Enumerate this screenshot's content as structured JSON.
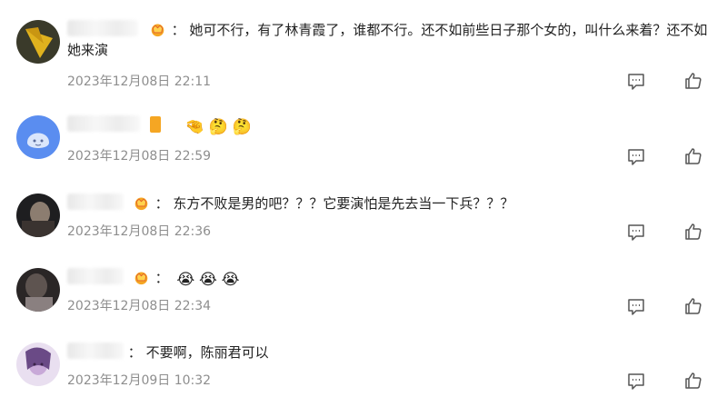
{
  "comments": [
    {
      "username": "",
      "separator": "：",
      "text": "她可不行，有了林青霞了，谁都不行。还不如前些日子那个女的，叫什么来着？还不如她来演",
      "timestamp": "2023年12月08日 22:11",
      "has_badge": true,
      "emojis": []
    },
    {
      "username": "",
      "separator": "",
      "text": "",
      "timestamp": "2023年12月08日 22:59",
      "has_badge": false,
      "emojis": [
        "🤏",
        "🤔",
        "🤔"
      ]
    },
    {
      "username": "",
      "separator": "：",
      "text": "东方不败是男的吧？？？它要演怕是先去当一下兵？？？",
      "timestamp": "2023年12月08日 22:36",
      "has_badge": true,
      "emojis": []
    },
    {
      "username": "",
      "separator": "：",
      "text": "",
      "timestamp": "2023年12月08日 22:34",
      "has_badge": true,
      "emojis": [
        "😭",
        "😭",
        "😭"
      ]
    },
    {
      "username": "",
      "separator": "：",
      "text": "不要啊，陈丽君可以",
      "timestamp": "2023年12月09日 10:32",
      "has_badge": false,
      "emojis": []
    }
  ],
  "icons": {
    "reply": "comment-icon",
    "like": "thumbs-up-icon",
    "badge": "crown-badge-icon"
  },
  "colors": {
    "text": "#222222",
    "timestamp": "#8e8e8e",
    "icon": "#555555",
    "badge": "#f5a623"
  }
}
